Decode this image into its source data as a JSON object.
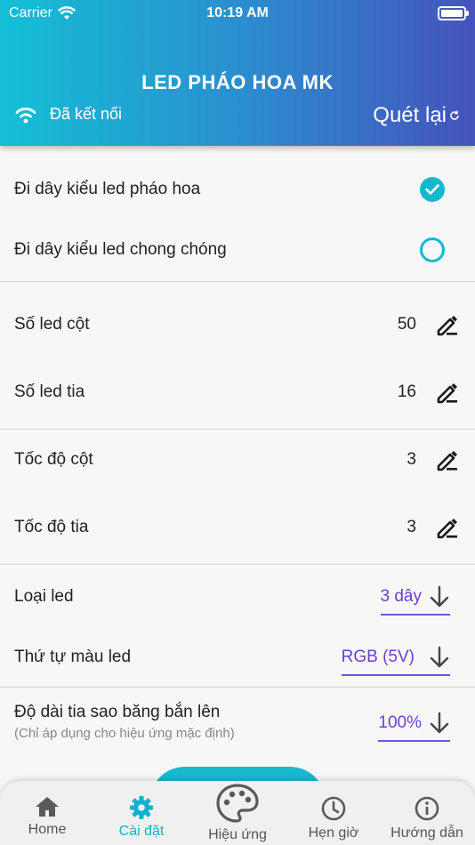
{
  "status": {
    "carrier": "Carrier",
    "time": "10:19 AM"
  },
  "header": {
    "title": "LED PHÁO HOA MK",
    "connection": "Đã kết nối",
    "rescan": "Quét lại"
  },
  "wiring": {
    "fireworks": {
      "label": "Đi dây kiểu led pháo hoa",
      "selected": true
    },
    "pinwheel": {
      "label": "Đi dây kiểu led chong chóng",
      "selected": false
    }
  },
  "settings": {
    "led_column": {
      "label": "Số led cột",
      "value": "50"
    },
    "led_ray": {
      "label": "Số led tia",
      "value": "16"
    },
    "speed_column": {
      "label": "Tốc độ cột",
      "value": "3"
    },
    "speed_ray": {
      "label": "Tốc độ tia",
      "value": "3"
    },
    "led_type": {
      "label": "Loại led",
      "value": "3 dây"
    },
    "color_order": {
      "label": "Thứ tự màu led",
      "value": "RGB (5V)"
    },
    "ray_length": {
      "label": "Độ dài tia sao băng bắn lên",
      "note": "(Chỉ áp dụng cho hiệu ứng mặc định)",
      "value": "100%"
    }
  },
  "nav": {
    "home": "Home",
    "settings": "Cài đặt",
    "effects": "Hiệu ứng",
    "timer": "Hẹn giờ",
    "guide": "Hướng dẫn"
  },
  "colors": {
    "accent": "#12b8d0",
    "purple": "#6a3fd6",
    "header_left": "#14bfd4",
    "header_right": "#4553bd"
  }
}
